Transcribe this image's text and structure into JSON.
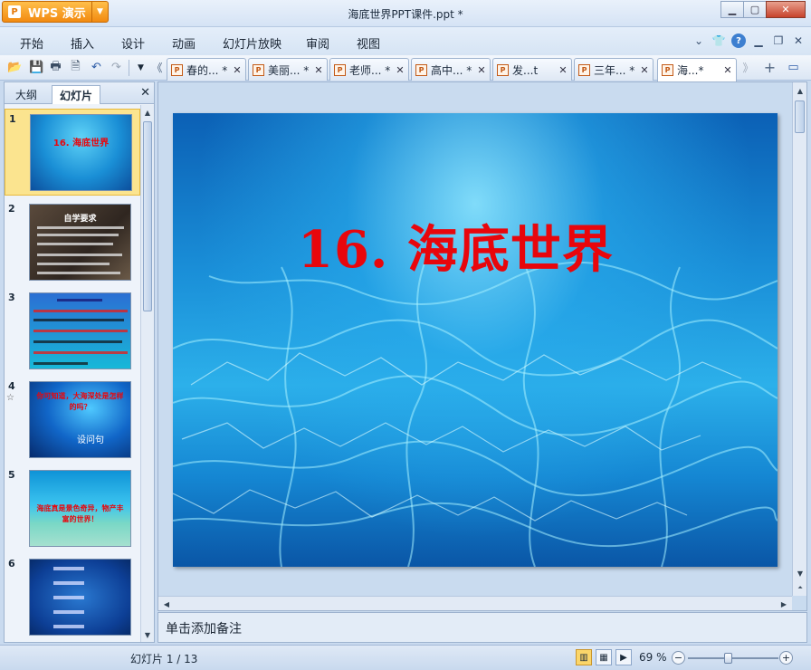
{
  "app": {
    "name": "WPS 演示",
    "logo_glyph": "P",
    "title": "海底世界PPT课件.ppt *"
  },
  "window_controls": {
    "minimize": "▁",
    "maximize": "▢",
    "close": "✕"
  },
  "menu": {
    "items": [
      "开始",
      "插入",
      "设计",
      "动画",
      "幻灯片放映",
      "审阅",
      "视图"
    ],
    "right_icons": [
      "chevron-down-icon",
      "shirt-icon",
      "help-icon",
      "minimize-icon",
      "restore-icon",
      "close-icon"
    ],
    "help_glyph": "?"
  },
  "toolbar": {
    "icons": [
      "open-folder-icon",
      "save-icon",
      "print-icon",
      "print-preview-icon",
      "undo-icon",
      "redo-icon",
      "dropdown-icon"
    ],
    "tab_left_arrow": "《",
    "tab_right_arrow": "》",
    "new_tab": "+"
  },
  "doc_tabs": [
    {
      "label": "春的... *",
      "active": false
    },
    {
      "label": "美丽... *",
      "active": false
    },
    {
      "label": "老师... *",
      "active": false
    },
    {
      "label": "高中... *",
      "active": false
    },
    {
      "label": "发...t",
      "active": false
    },
    {
      "label": "三年... *",
      "active": false
    },
    {
      "label": "海...*",
      "active": true
    }
  ],
  "left_panel": {
    "tabs": [
      "大纲",
      "幻灯片"
    ],
    "active_tab": "幻灯片",
    "close": "✕",
    "thumbnails": [
      {
        "number": "1",
        "text": "16. 海底世界",
        "style": "water",
        "selected": true
      },
      {
        "number": "2",
        "text": "自学要求",
        "style": "dark",
        "selected": false
      },
      {
        "number": "3",
        "text": "",
        "style": "bar",
        "selected": false
      },
      {
        "number": "4",
        "text": "你可知道，大海深处是怎样的吗？",
        "sub": "设问句",
        "style": "deep",
        "selected": false,
        "has_animation": true
      },
      {
        "number": "5",
        "text": "海底真是景色奇异，物产丰富的世界！",
        "style": "sea",
        "selected": false
      },
      {
        "number": "6",
        "text": "",
        "style": "fish",
        "selected": false
      }
    ]
  },
  "slide": {
    "title": "16. 海底世界",
    "title_color": "#e8060c"
  },
  "notes": {
    "placeholder": "单击添加备注"
  },
  "status": {
    "slide_info": "幻灯片 1 / 13",
    "zoom": "69 %",
    "zoom_minus": "−",
    "zoom_plus": "+",
    "zoom_level": 0.45,
    "view_modes": [
      "normal-view-icon",
      "slide-sorter-icon",
      "slideshow-icon"
    ]
  }
}
